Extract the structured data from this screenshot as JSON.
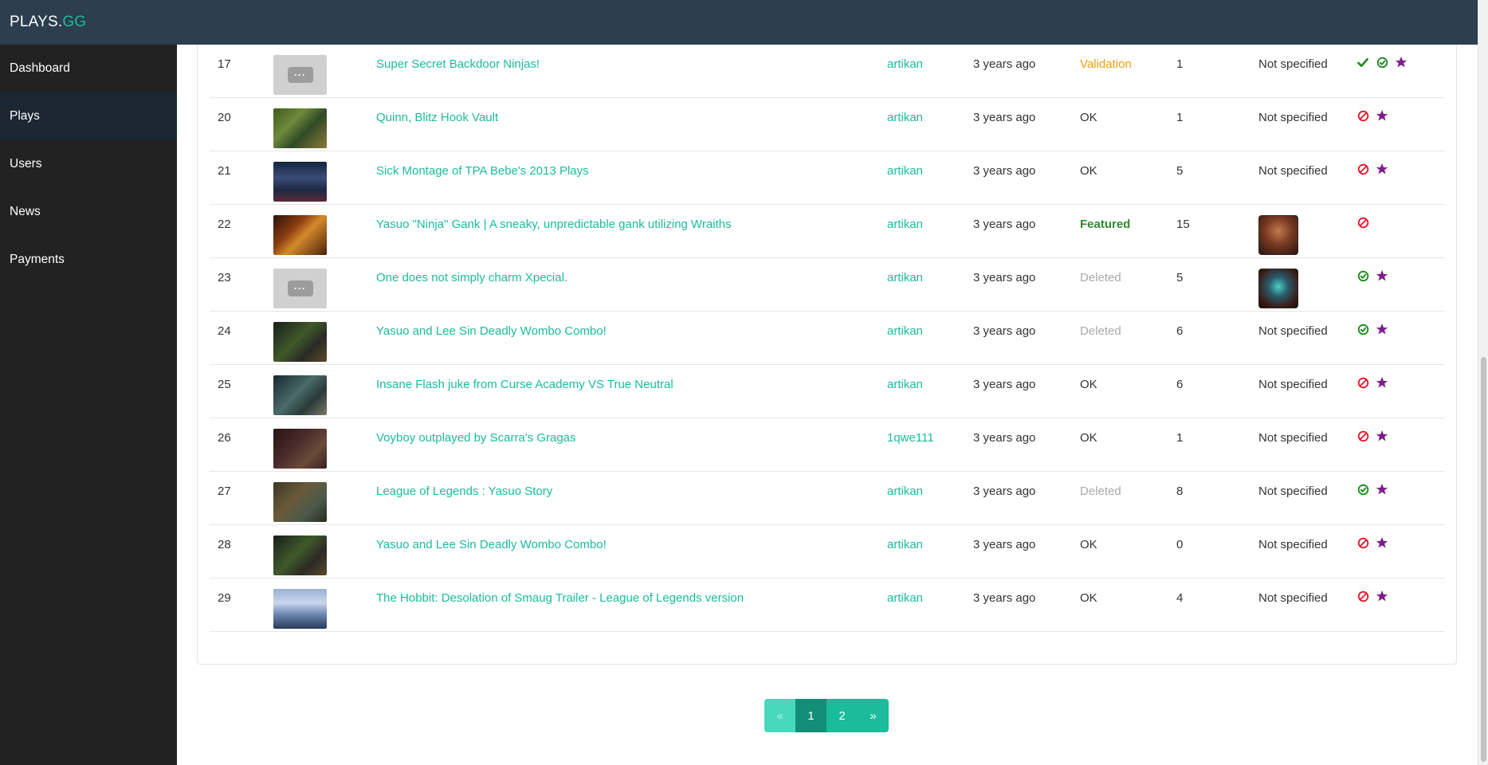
{
  "brand": {
    "main": "PLAYS.",
    "accent": "GG"
  },
  "nav": [
    {
      "label": "Dashboard",
      "active": false
    },
    {
      "label": "Plays",
      "active": true
    },
    {
      "label": "Users",
      "active": false
    },
    {
      "label": "News",
      "active": false
    },
    {
      "label": "Payments",
      "active": false
    }
  ],
  "rows": [
    {
      "id": "17",
      "thumb": "placeholder",
      "title": "Super Secret Backdoor Ninjas!",
      "user": "artikan",
      "time": "3 years ago",
      "status": "Validation",
      "status_kind": "validation",
      "count": "1",
      "champion": "Not specified",
      "avatar": "",
      "actions": [
        "check",
        "check-circle",
        "star"
      ]
    },
    {
      "id": "20",
      "thumb": "green",
      "title": "Quinn, Blitz Hook Vault",
      "user": "artikan",
      "time": "3 years ago",
      "status": "OK",
      "status_kind": "ok",
      "count": "1",
      "champion": "Not specified",
      "avatar": "",
      "actions": [
        "ban",
        "star"
      ]
    },
    {
      "id": "21",
      "thumb": "stream",
      "title": "Sick Montage of TPA Bebe's 2013 Plays",
      "user": "artikan",
      "time": "3 years ago",
      "status": "OK",
      "status_kind": "ok",
      "count": "5",
      "champion": "Not specified",
      "avatar": "",
      "actions": [
        "ban",
        "star"
      ]
    },
    {
      "id": "22",
      "thumb": "yasuo",
      "title": "Yasuo \"Ninja\" Gank | A sneaky, unpredictable gank utilizing Wraiths",
      "user": "artikan",
      "time": "3 years ago",
      "status": "Featured",
      "status_kind": "featured",
      "count": "15",
      "champion": "",
      "avatar": "darius",
      "actions": [
        "ban"
      ]
    },
    {
      "id": "23",
      "thumb": "placeholder",
      "title": "One does not simply charm Xpecial.",
      "user": "artikan",
      "time": "3 years ago",
      "status": "Deleted",
      "status_kind": "deleted",
      "count": "5",
      "champion": "",
      "avatar": "ninja",
      "actions": [
        "check-circle",
        "star"
      ]
    },
    {
      "id": "24",
      "thumb": "dark1",
      "title": "Yasuo and Lee Sin Deadly Wombo Combo!",
      "user": "artikan",
      "time": "3 years ago",
      "status": "Deleted",
      "status_kind": "deleted",
      "count": "6",
      "champion": "Not specified",
      "avatar": "",
      "actions": [
        "check-circle",
        "star"
      ]
    },
    {
      "id": "25",
      "thumb": "dark2",
      "title": "Insane Flash juke from Curse Academy VS True Neutral",
      "user": "artikan",
      "time": "3 years ago",
      "status": "OK",
      "status_kind": "ok",
      "count": "6",
      "champion": "Not specified",
      "avatar": "",
      "actions": [
        "ban",
        "star"
      ]
    },
    {
      "id": "26",
      "thumb": "dark3",
      "title": "Voyboy outplayed by Scarra's Gragas",
      "user": "1qwe111",
      "time": "3 years ago",
      "status": "OK",
      "status_kind": "ok",
      "count": "1",
      "champion": "Not specified",
      "avatar": "",
      "actions": [
        "ban",
        "star"
      ]
    },
    {
      "id": "27",
      "thumb": "dark4",
      "title": "League of Legends : Yasuo Story",
      "user": "artikan",
      "time": "3 years ago",
      "status": "Deleted",
      "status_kind": "deleted",
      "count": "8",
      "champion": "Not specified",
      "avatar": "",
      "actions": [
        "check-circle",
        "star"
      ]
    },
    {
      "id": "28",
      "thumb": "dark1",
      "title": "Yasuo and Lee Sin Deadly Wombo Combo!",
      "user": "artikan",
      "time": "3 years ago",
      "status": "OK",
      "status_kind": "ok",
      "count": "0",
      "champion": "Not specified",
      "avatar": "",
      "actions": [
        "ban",
        "star"
      ]
    },
    {
      "id": "29",
      "thumb": "ice",
      "title": "The Hobbit: Desolation of Smaug Trailer - League of Legends version",
      "user": "artikan",
      "time": "3 years ago",
      "status": "OK",
      "status_kind": "ok",
      "count": "4",
      "champion": "Not specified",
      "avatar": "",
      "actions": [
        "ban",
        "star"
      ]
    }
  ],
  "pagination": {
    "prev": "«",
    "pages": [
      "1",
      "2"
    ],
    "active": "1",
    "next": "»"
  },
  "colors": {
    "accent": "#1abc9c",
    "topbar": "#2c3e50",
    "sidebar": "#222222",
    "ban": "#e6192b",
    "ok_icon": "#1e8a1e",
    "star": "#7b1f8a",
    "validation": "#f39c12",
    "featured": "#2e8b2e",
    "deleted": "#aaaaaa"
  }
}
